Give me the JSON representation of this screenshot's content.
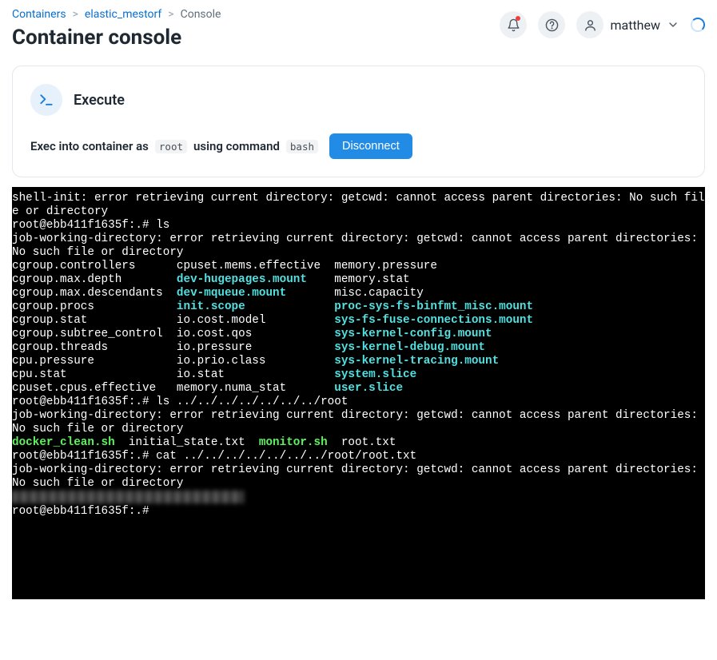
{
  "breadcrumb": {
    "items": [
      {
        "label": "Containers",
        "link": true
      },
      {
        "label": "elastic_mestorf",
        "link": true
      },
      {
        "label": "Console",
        "link": false
      }
    ]
  },
  "page_title": "Container console",
  "user": {
    "name": "matthew"
  },
  "card": {
    "title": "Execute",
    "line_prefix": "Exec into container as",
    "user_badge": "root",
    "line_mid": "using command",
    "cmd_badge": "bash",
    "button": "Disconnect"
  },
  "terminal": {
    "lines": [
      {
        "segs": [
          {
            "text": "shell-init: error retrieving current directory: getcwd: cannot access parent directories: No such file or directory",
            "cls": "t-plain"
          }
        ]
      },
      {
        "segs": [
          {
            "text": "root@ebb411f1635f:.# ls",
            "cls": "t-plain"
          }
        ]
      },
      {
        "segs": [
          {
            "text": "job-working-directory: error retrieving current directory: getcwd: cannot access parent directories: No such file or directory",
            "cls": "t-plain"
          }
        ]
      },
      {
        "segs": [
          {
            "text": "cgroup.controllers      ",
            "cls": "t-plain"
          },
          {
            "text": "cpuset.mems.effective  ",
            "cls": "t-plain"
          },
          {
            "text": "memory.pressure",
            "cls": "t-plain"
          }
        ]
      },
      {
        "segs": [
          {
            "text": "cgroup.max.depth        ",
            "cls": "t-plain"
          },
          {
            "text": "dev-hugepages.mount",
            "cls": "t-cyan"
          },
          {
            "text": "    memory.stat",
            "cls": "t-plain"
          }
        ]
      },
      {
        "segs": [
          {
            "text": "cgroup.max.descendants  ",
            "cls": "t-plain"
          },
          {
            "text": "dev-mqueue.mount",
            "cls": "t-cyan"
          },
          {
            "text": "       misc.capacity",
            "cls": "t-plain"
          }
        ]
      },
      {
        "segs": [
          {
            "text": "cgroup.procs            ",
            "cls": "t-plain"
          },
          {
            "text": "init.scope",
            "cls": "t-cyan"
          },
          {
            "text": "             ",
            "cls": "t-plain"
          },
          {
            "text": "proc-sys-fs-binfmt_misc.mount",
            "cls": "t-cyan"
          }
        ]
      },
      {
        "segs": [
          {
            "text": "cgroup.stat             ",
            "cls": "t-plain"
          },
          {
            "text": "io.cost.model          ",
            "cls": "t-plain"
          },
          {
            "text": "sys-fs-fuse-connections.mount",
            "cls": "t-cyan"
          }
        ]
      },
      {
        "segs": [
          {
            "text": "cgroup.subtree_control  ",
            "cls": "t-plain"
          },
          {
            "text": "io.cost.qos            ",
            "cls": "t-plain"
          },
          {
            "text": "sys-kernel-config.mount",
            "cls": "t-cyan"
          }
        ]
      },
      {
        "segs": [
          {
            "text": "cgroup.threads          ",
            "cls": "t-plain"
          },
          {
            "text": "io.pressure            ",
            "cls": "t-plain"
          },
          {
            "text": "sys-kernel-debug.mount",
            "cls": "t-cyan"
          }
        ]
      },
      {
        "segs": [
          {
            "text": "cpu.pressure            ",
            "cls": "t-plain"
          },
          {
            "text": "io.prio.class          ",
            "cls": "t-plain"
          },
          {
            "text": "sys-kernel-tracing.mount",
            "cls": "t-cyan"
          }
        ]
      },
      {
        "segs": [
          {
            "text": "cpu.stat                ",
            "cls": "t-plain"
          },
          {
            "text": "io.stat                ",
            "cls": "t-plain"
          },
          {
            "text": "system.slice",
            "cls": "t-cyan"
          }
        ]
      },
      {
        "segs": [
          {
            "text": "cpuset.cpus.effective   ",
            "cls": "t-plain"
          },
          {
            "text": "memory.numa_stat       ",
            "cls": "t-plain"
          },
          {
            "text": "user.slice",
            "cls": "t-cyan"
          }
        ]
      },
      {
        "segs": [
          {
            "text": "root@ebb411f1635f:.# ls ../../../../../../../root",
            "cls": "t-plain"
          }
        ]
      },
      {
        "segs": [
          {
            "text": "job-working-directory: error retrieving current directory: getcwd: cannot access parent directories: No such file or directory",
            "cls": "t-plain"
          }
        ]
      },
      {
        "segs": [
          {
            "text": "docker_clean.sh",
            "cls": "t-green"
          },
          {
            "text": "  initial_state.txt  ",
            "cls": "t-plain"
          },
          {
            "text": "monitor.sh",
            "cls": "t-green"
          },
          {
            "text": "  root.txt",
            "cls": "t-plain"
          }
        ]
      },
      {
        "segs": [
          {
            "text": "root@ebb411f1635f:.# cat ../../../../../../../root/root.txt",
            "cls": "t-plain"
          }
        ]
      },
      {
        "segs": [
          {
            "text": "job-working-directory: error retrieving current directory: getcwd: cannot access parent directories: No such file or directory",
            "cls": "t-plain"
          }
        ]
      },
      {
        "blur": true
      },
      {
        "segs": [
          {
            "text": "root@ebb411f1635f:.# ",
            "cls": "t-plain"
          }
        ]
      }
    ]
  }
}
